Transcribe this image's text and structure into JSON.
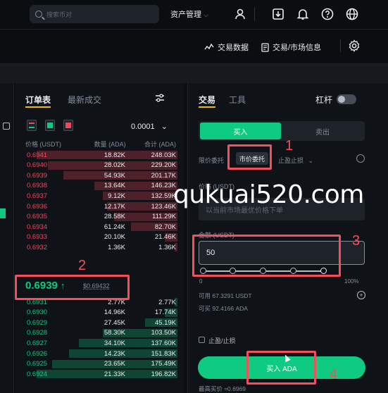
{
  "header": {
    "search_placeholder": "搜索币对",
    "assets_menu": "资产管理",
    "icons": [
      "user-icon",
      "download-icon",
      "bell-icon",
      "help-icon",
      "globe-icon"
    ]
  },
  "toolbar": {
    "trading_data": "交易数据",
    "trading_info": "交易/市场信息"
  },
  "orderbook": {
    "tabs": [
      "订单表",
      "最新成交"
    ],
    "precision": "0.0001",
    "columns": [
      "价格 (USDT)",
      "数量 (ADA)",
      "合计 (ADA)"
    ],
    "asks": [
      {
        "price": "0.6941",
        "qty": "18.82K",
        "total": "248.03K",
        "depth": 1.0
      },
      {
        "price": "0.6940",
        "qty": "28.02K",
        "total": "229.20K",
        "depth": 0.92
      },
      {
        "price": "0.6939",
        "qty": "54.93K",
        "total": "201.17K",
        "depth": 0.81
      },
      {
        "price": "0.6938",
        "qty": "13.64K",
        "total": "146.23K",
        "depth": 0.59
      },
      {
        "price": "0.6937",
        "qty": "9.12K",
        "total": "132.59K",
        "depth": 0.53
      },
      {
        "price": "0.6936",
        "qty": "12.17K",
        "total": "123.46K",
        "depth": 0.5
      },
      {
        "price": "0.6935",
        "qty": "28.58K",
        "total": "111.29K",
        "depth": 0.45
      },
      {
        "price": "0.6934",
        "qty": "61.24K",
        "total": "82.70K",
        "depth": 0.33
      },
      {
        "price": "0.6933",
        "qty": "20.10K",
        "total": "21.46K",
        "depth": 0.09
      },
      {
        "price": "0.6932",
        "qty": "1.36K",
        "total": "1.36K",
        "depth": 0.02
      }
    ],
    "last_price": "0.6939",
    "mark_price": "$0.69432",
    "bids": [
      {
        "price": "0.6931",
        "qty": "2.77K",
        "total": "2.77K",
        "depth": 0.02
      },
      {
        "price": "0.6930",
        "qty": "14.96K",
        "total": "17.74K",
        "depth": 0.09
      },
      {
        "price": "0.6929",
        "qty": "27.45K",
        "total": "45.19K",
        "depth": 0.23
      },
      {
        "price": "0.6928",
        "qty": "58.30K",
        "total": "103.50K",
        "depth": 0.53
      },
      {
        "price": "0.6927",
        "qty": "34.10K",
        "total": "137.60K",
        "depth": 0.7
      },
      {
        "price": "0.6926",
        "qty": "14.23K",
        "total": "151.83K",
        "depth": 0.77
      },
      {
        "price": "0.6925",
        "qty": "23.65K",
        "total": "175.49K",
        "depth": 0.89
      },
      {
        "price": "0.6924",
        "qty": "21.33K",
        "total": "196.82K",
        "depth": 1.0
      }
    ]
  },
  "trade": {
    "tabs": [
      "交易",
      "工具"
    ],
    "leverage_label": "杠杆",
    "buy_tab": "买入",
    "sell_tab": "卖出",
    "order_types": [
      "限价委托",
      "市价委托",
      "止盈止损"
    ],
    "price_label": "价格 (USDT)",
    "price_placeholder": "以当前市场最优价格下单",
    "total_label": "金额 (USDT)",
    "total_value": "50",
    "slider_min": "0",
    "slider_max": "100%",
    "slider_percent": 1.0,
    "available": "可用 67.3291 USDT",
    "can_buy": "可买 92.4166 ADA",
    "tpsl_label": "止盈/止损",
    "buy_button": "买入 ADA",
    "max_buy": "最高买价 ≈0.6969"
  },
  "annotations": [
    "1",
    "2",
    "3",
    "4"
  ],
  "watermark": "qukuai520.com",
  "colors": {
    "green": "#0ecb81",
    "red": "#f6465d",
    "accent": "#f0b90b",
    "annotation": "#f44f5a"
  }
}
